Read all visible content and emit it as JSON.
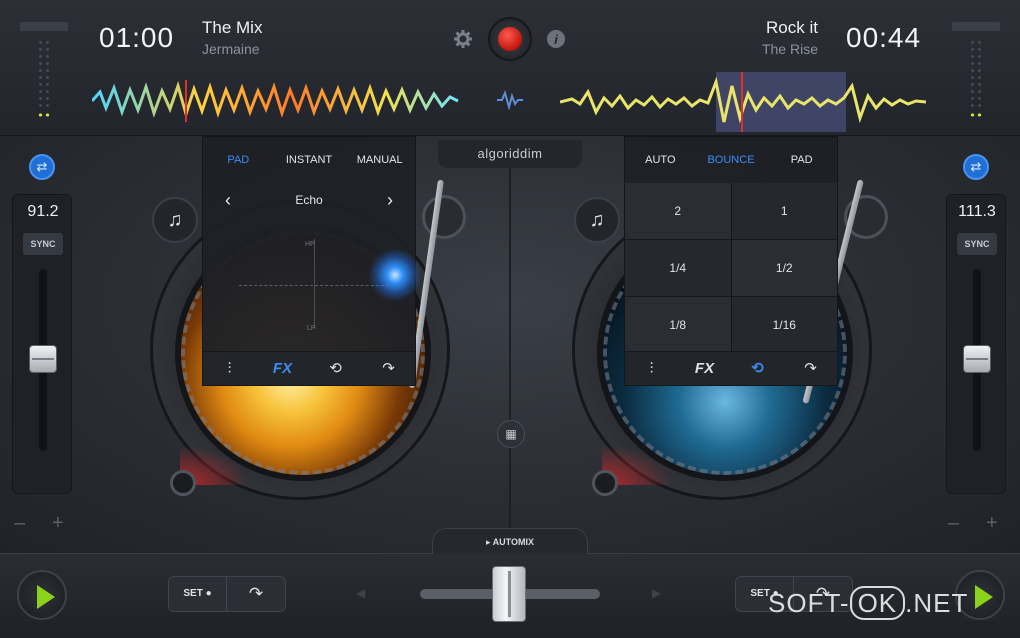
{
  "left_deck": {
    "time": "01:00",
    "title": "The Mix",
    "artist": "Jermaine",
    "bpm": "91.2",
    "sync_label": "SYNC",
    "minus": "–",
    "plus": "+"
  },
  "right_deck": {
    "time": "00:44",
    "title": "Rock it",
    "artist": "The Rise",
    "bpm": "111.3",
    "sync_label": "SYNC",
    "minus": "–",
    "plus": "+"
  },
  "top_icons": {
    "settings": "gear-icon",
    "record": "record-icon",
    "info": "info-icon",
    "info_glyph": "i"
  },
  "logo": {
    "text": "algoriddim"
  },
  "fx_panel": {
    "tabs": [
      "PAD",
      "INSTANT",
      "MANUAL"
    ],
    "active_tab": "PAD",
    "effect_name": "Echo",
    "prev": "‹",
    "next": "›",
    "axis_top": "HP",
    "axis_bottom": "LP",
    "footer": [
      "eq-icon",
      "fx-icon",
      "loop-icon",
      "jump-icon"
    ],
    "footer_fx_label": "FX"
  },
  "loop_panel": {
    "tabs": [
      "AUTO",
      "BOUNCE",
      "PAD"
    ],
    "active_tab": "BOUNCE",
    "cells": [
      "2",
      "1",
      "1/4",
      "1/2",
      "1/8",
      "1/16"
    ],
    "footer_fx_label": "FX"
  },
  "center": {
    "automix_label": "AUTOMIX",
    "grid_icon": "grid-icon"
  },
  "bottom": {
    "set_label": "SET",
    "left_arrow": "◀",
    "right_arrow": "▶"
  },
  "watermark": {
    "pre": "SOFT-",
    "ok": "OK",
    "post": ".NET"
  },
  "colors": {
    "accent_blue": "#3b8df3",
    "record_red": "#d0201a",
    "play_green": "#8bd31a"
  }
}
